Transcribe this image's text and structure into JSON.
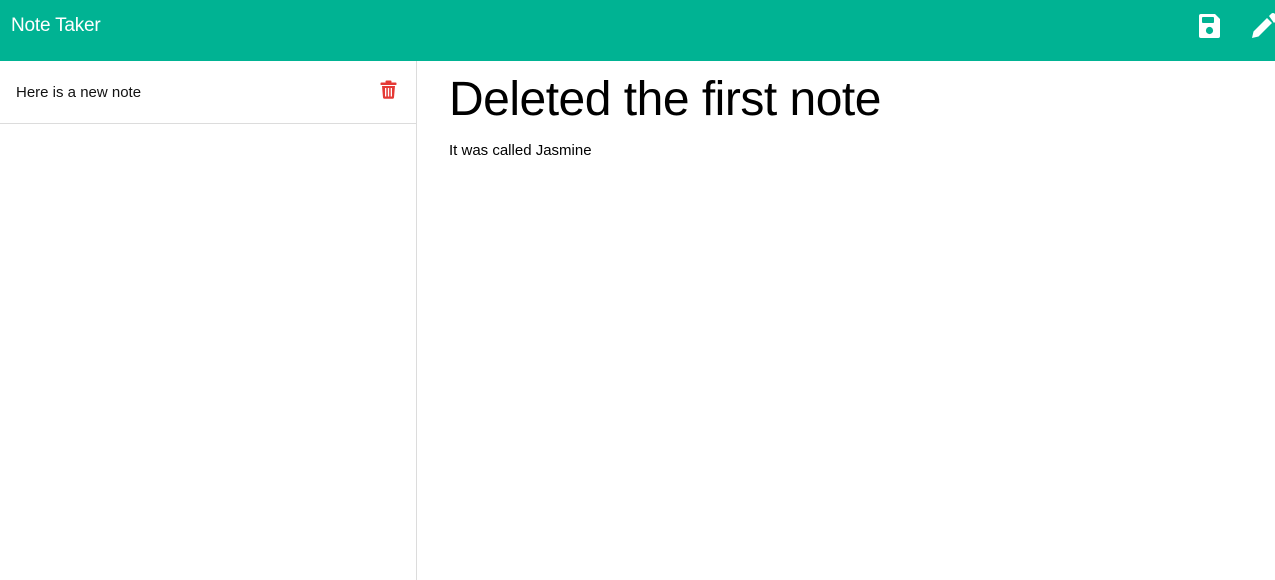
{
  "navbar": {
    "brand": "Note Taker",
    "background_color": "#00b393",
    "save_icon": "floppy-disk-icon",
    "edit_icon": "pencil-icon"
  },
  "sidebar": {
    "notes": [
      {
        "title": "Here is a new note",
        "delete_icon": "trash-icon",
        "delete_color": "#e53935"
      }
    ]
  },
  "main": {
    "note_title": "Deleted the first note",
    "note_text": "It was called Jasmine"
  }
}
